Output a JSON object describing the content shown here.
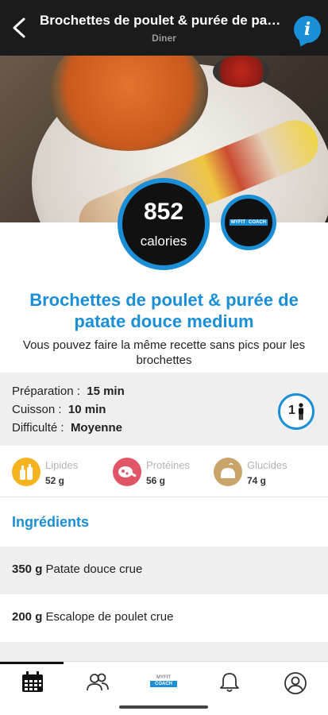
{
  "header": {
    "title": "Brochettes de poulet & purée de pat...",
    "subtitle": "Diner",
    "back_icon": "arrow-left-icon",
    "info_icon": "info-icon",
    "info_glyph": "i"
  },
  "hero": {
    "calories_value": "852",
    "calories_label": "calories",
    "brand_logo_text_1": "MYFIT",
    "brand_logo_text_2": "COACH"
  },
  "recipe": {
    "title": "Brochettes de poulet & purée de patate douce medium",
    "description": "Vous pouvez faire la même recette sans pics pour les brochettes"
  },
  "meta": {
    "prep_label": "Préparation :",
    "prep_value": "15 min",
    "cook_label": "Cuisson :",
    "cook_value": "10 min",
    "difficulty_label": "Difficulté :",
    "difficulty_value": "Moyenne",
    "servings": "1",
    "servings_icon": "person-icon"
  },
  "macros": [
    {
      "name": "Lipides",
      "value": "52 g",
      "color": "#f4b31f",
      "icon": "oil-bottle-icon"
    },
    {
      "name": "Protéines",
      "value": "56 g",
      "color": "#e05666",
      "icon": "meat-icon"
    },
    {
      "name": "Glucides",
      "value": "74 g",
      "color": "#c9a46a",
      "icon": "bread-icon"
    }
  ],
  "ingredients": {
    "heading": "Ingrédients",
    "items": [
      {
        "qty": "350 g",
        "name": "Patate douce crue"
      },
      {
        "qty": "200 g",
        "name": "Escalope de poulet crue"
      }
    ]
  },
  "nav": {
    "items": [
      {
        "icon": "calendar-icon",
        "label": "calendar"
      },
      {
        "icon": "community-icon",
        "label": "community"
      },
      {
        "icon": "myfit-coach-logo-icon",
        "label": "myfit"
      },
      {
        "icon": "bell-icon",
        "label": "notifications"
      },
      {
        "icon": "profile-icon",
        "label": "profile"
      }
    ],
    "logo_text_1": "MYFIT",
    "logo_text_2": "COACH"
  },
  "colors": {
    "accent": "#1a8fd8",
    "topbar": "#1b1b1b",
    "section_bg": "#efefef"
  }
}
